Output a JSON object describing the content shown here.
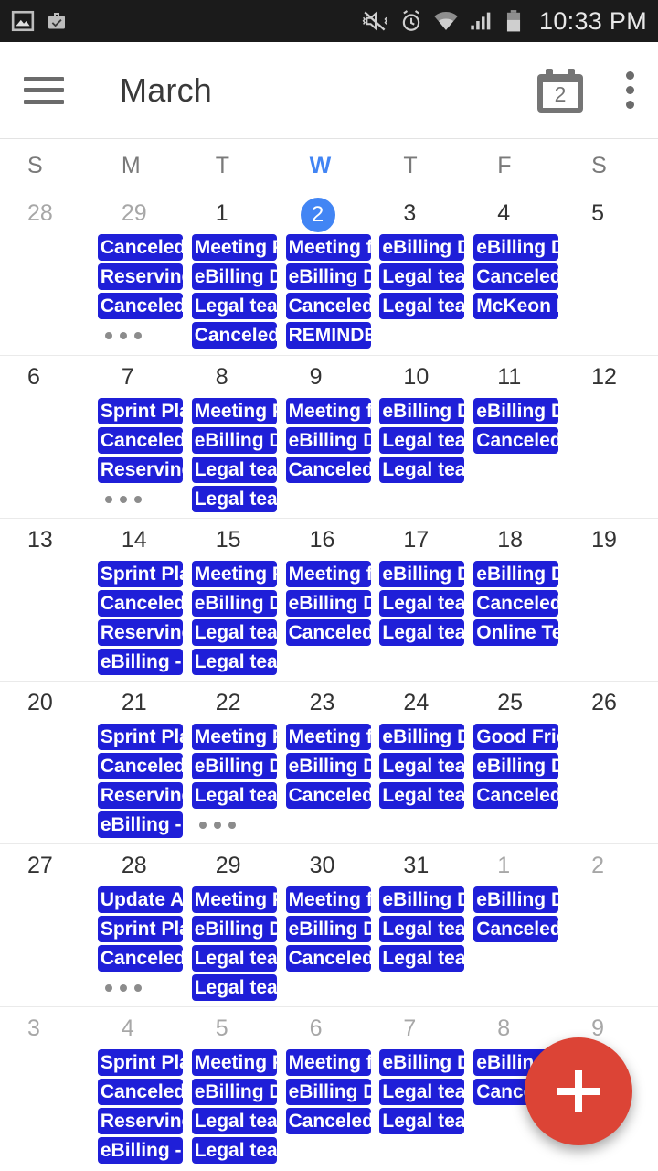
{
  "statusbar": {
    "time": "10:33 PM",
    "left_icons": [
      "screenshot-icon",
      "work-briefcase-icon"
    ],
    "right_icons": [
      "vibrate-mute-icon",
      "alarm-icon",
      "wifi-icon",
      "signal-icon",
      "battery-icon"
    ]
  },
  "toolbar": {
    "menu_icon": "hamburger-icon",
    "title": "March",
    "today_icon_day": "2",
    "overflow_icon": "kebab-menu-icon"
  },
  "weekdays": [
    {
      "label": "S",
      "today": false
    },
    {
      "label": "M",
      "today": false
    },
    {
      "label": "T",
      "today": false
    },
    {
      "label": "W",
      "today": true
    },
    {
      "label": "T",
      "today": false
    },
    {
      "label": "F",
      "today": false
    },
    {
      "label": "S",
      "today": false
    }
  ],
  "colors": {
    "event_chip": "#1f1fd8",
    "today_accent": "#4285f4",
    "fab": "#dc4436"
  },
  "fab": {
    "label": "+",
    "icon": "add-icon"
  },
  "weeks": [
    {
      "days": [
        {
          "num": "28",
          "muted": true,
          "today": false,
          "events": [],
          "more": false
        },
        {
          "num": "29",
          "muted": true,
          "today": false,
          "events": [
            "Canceled",
            "Reserving",
            "Canceled"
          ],
          "more": true
        },
        {
          "num": "1",
          "muted": false,
          "today": false,
          "events": [
            "Meeting P",
            "eBilling D",
            "Legal tea",
            "Canceled"
          ],
          "more": false
        },
        {
          "num": "2",
          "muted": false,
          "today": true,
          "events": [
            "Meeting f",
            "eBilling D",
            "Canceled",
            "REMINDE"
          ],
          "more": false
        },
        {
          "num": "3",
          "muted": false,
          "today": false,
          "events": [
            "eBilling D",
            "Legal tea",
            "Legal tea"
          ],
          "more": false
        },
        {
          "num": "4",
          "muted": false,
          "today": false,
          "events": [
            "eBilling D",
            "Canceled",
            "McKeon P"
          ],
          "more": false
        },
        {
          "num": "5",
          "muted": false,
          "today": false,
          "events": [],
          "more": false
        }
      ]
    },
    {
      "days": [
        {
          "num": "6",
          "muted": false,
          "today": false,
          "events": [],
          "more": false
        },
        {
          "num": "7",
          "muted": false,
          "today": false,
          "events": [
            "Sprint Pla",
            "Canceled",
            "Reserving"
          ],
          "more": true
        },
        {
          "num": "8",
          "muted": false,
          "today": false,
          "events": [
            "Meeting P",
            "eBilling D",
            "Legal tea",
            "Legal tea"
          ],
          "more": false
        },
        {
          "num": "9",
          "muted": false,
          "today": false,
          "events": [
            "Meeting f",
            "eBilling D",
            "Canceled"
          ],
          "more": false
        },
        {
          "num": "10",
          "muted": false,
          "today": false,
          "events": [
            "eBilling D",
            "Legal tea",
            "Legal tea"
          ],
          "more": false
        },
        {
          "num": "11",
          "muted": false,
          "today": false,
          "events": [
            "eBilling D",
            "Canceled"
          ],
          "more": false
        },
        {
          "num": "12",
          "muted": false,
          "today": false,
          "events": [],
          "more": false
        }
      ]
    },
    {
      "days": [
        {
          "num": "13",
          "muted": false,
          "today": false,
          "events": [],
          "more": false
        },
        {
          "num": "14",
          "muted": false,
          "today": false,
          "events": [
            "Sprint Pla",
            "Canceled",
            "Reserving",
            "eBilling -"
          ],
          "more": false
        },
        {
          "num": "15",
          "muted": false,
          "today": false,
          "events": [
            "Meeting P",
            "eBilling D",
            "Legal tea",
            "Legal tea"
          ],
          "more": false
        },
        {
          "num": "16",
          "muted": false,
          "today": false,
          "events": [
            "Meeting f",
            "eBilling D",
            "Canceled"
          ],
          "more": false
        },
        {
          "num": "17",
          "muted": false,
          "today": false,
          "events": [
            "eBilling D",
            "Legal tea",
            "Legal tea"
          ],
          "more": false
        },
        {
          "num": "18",
          "muted": false,
          "today": false,
          "events": [
            "eBilling D",
            "Canceled",
            "Online Te"
          ],
          "more": false
        },
        {
          "num": "19",
          "muted": false,
          "today": false,
          "events": [],
          "more": false
        }
      ]
    },
    {
      "days": [
        {
          "num": "20",
          "muted": false,
          "today": false,
          "events": [],
          "more": false
        },
        {
          "num": "21",
          "muted": false,
          "today": false,
          "events": [
            "Sprint Pla",
            "Canceled",
            "Reserving",
            "eBilling -"
          ],
          "more": false
        },
        {
          "num": "22",
          "muted": false,
          "today": false,
          "events": [
            "Meeting P",
            "eBilling D",
            "Legal tea"
          ],
          "more": true
        },
        {
          "num": "23",
          "muted": false,
          "today": false,
          "events": [
            "Meeting f",
            "eBilling D",
            "Canceled"
          ],
          "more": false
        },
        {
          "num": "24",
          "muted": false,
          "today": false,
          "events": [
            "eBilling D",
            "Legal tea",
            "Legal tea"
          ],
          "more": false
        },
        {
          "num": "25",
          "muted": false,
          "today": false,
          "events": [
            "Good Frid",
            "eBilling D",
            "Canceled"
          ],
          "more": false
        },
        {
          "num": "26",
          "muted": false,
          "today": false,
          "events": [],
          "more": false
        }
      ]
    },
    {
      "days": [
        {
          "num": "27",
          "muted": false,
          "today": false,
          "events": [],
          "more": false
        },
        {
          "num": "28",
          "muted": false,
          "today": false,
          "events": [
            "Update A",
            "Sprint Pla",
            "Canceled"
          ],
          "more": true
        },
        {
          "num": "29",
          "muted": false,
          "today": false,
          "events": [
            "Meeting P",
            "eBilling D",
            "Legal tea",
            "Legal tea"
          ],
          "more": false
        },
        {
          "num": "30",
          "muted": false,
          "today": false,
          "events": [
            "Meeting f",
            "eBilling D",
            "Canceled"
          ],
          "more": false
        },
        {
          "num": "31",
          "muted": false,
          "today": false,
          "events": [
            "eBilling D",
            "Legal tea",
            "Legal tea"
          ],
          "more": false
        },
        {
          "num": "1",
          "muted": true,
          "today": false,
          "events": [
            "eBilling D",
            "Canceled"
          ],
          "more": false
        },
        {
          "num": "2",
          "muted": true,
          "today": false,
          "events": [],
          "more": false
        }
      ]
    },
    {
      "days": [
        {
          "num": "3",
          "muted": true,
          "today": false,
          "events": [],
          "more": false
        },
        {
          "num": "4",
          "muted": true,
          "today": false,
          "events": [
            "Sprint Pla",
            "Canceled",
            "Reserving",
            "eBilling -"
          ],
          "more": false
        },
        {
          "num": "5",
          "muted": true,
          "today": false,
          "events": [
            "Meeting P",
            "eBilling D",
            "Legal tea",
            "Legal tea"
          ],
          "more": false
        },
        {
          "num": "6",
          "muted": true,
          "today": false,
          "events": [
            "Meeting f",
            "eBilling D",
            "Canceled"
          ],
          "more": false
        },
        {
          "num": "7",
          "muted": true,
          "today": false,
          "events": [
            "eBilling D",
            "Legal tea",
            "Legal tea"
          ],
          "more": false
        },
        {
          "num": "8",
          "muted": true,
          "today": false,
          "events": [
            "eBilling D",
            "Canceled"
          ],
          "more": false
        },
        {
          "num": "9",
          "muted": true,
          "today": false,
          "events": [],
          "more": false
        }
      ]
    }
  ]
}
